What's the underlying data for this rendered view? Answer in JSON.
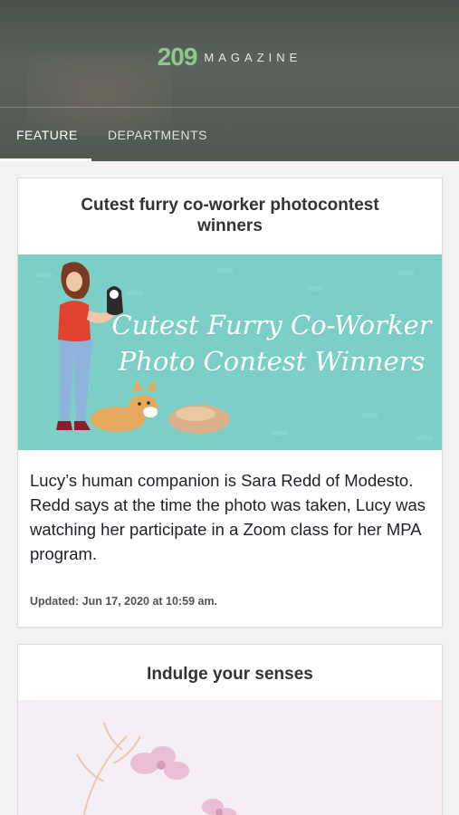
{
  "header": {
    "logo_number": "209",
    "logo_word": "MAGAZINE"
  },
  "tabs": [
    {
      "label": "FEATURE",
      "active": true
    },
    {
      "label": "DEPARTMENTS",
      "active": false
    }
  ],
  "articles": [
    {
      "title": "Cutest furry co-worker photocontest winners",
      "image_text_line1": "Cutest Furry Co-Worker",
      "image_text_line2": "Photo Contest Winners",
      "body": "Lucy’s human companion is Sara Redd of Modesto.\nRedd says at the time the photo was taken, Lucy was watching her participate in a Zoom class for her MPA program.",
      "body_line1": "Lucy’s human companion is Sara Redd of Modesto.",
      "body_line2": "Redd says at the time the photo was taken, Lucy was watching her participate in a Zoom class for her MPA program.",
      "updated": "Updated: Jun 17, 2020 at 10:59 am."
    },
    {
      "title": "Indulge your senses"
    }
  ],
  "colors": {
    "header_bg": "#4f5852",
    "logo_green": "#8fc98a",
    "hero_teal": "#7bcfc6",
    "hero2_pink": "#f6eef5"
  }
}
